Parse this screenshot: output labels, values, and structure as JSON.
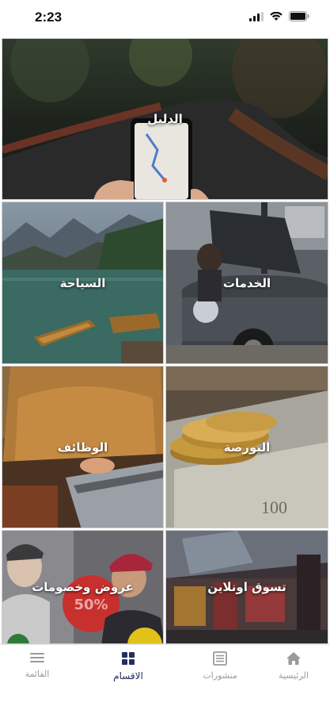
{
  "status_bar": {
    "time": "2:23"
  },
  "tiles": {
    "guide": "الدليل",
    "services": "الخدمات",
    "tourism": "السياحة",
    "stock": "البورصة",
    "jobs": "الوظائف",
    "shop": "تسوق اونلاين",
    "offers": "عروض وخصومات",
    "offers_badge": "50%"
  },
  "tabbar": {
    "home": "الرئيسية",
    "posts": "منشورات",
    "sections": "الاقسام",
    "menu": "القائمة",
    "active": "sections"
  },
  "colors": {
    "active_tab": "#23305e",
    "inactive_tab": "#9a9a9a"
  }
}
